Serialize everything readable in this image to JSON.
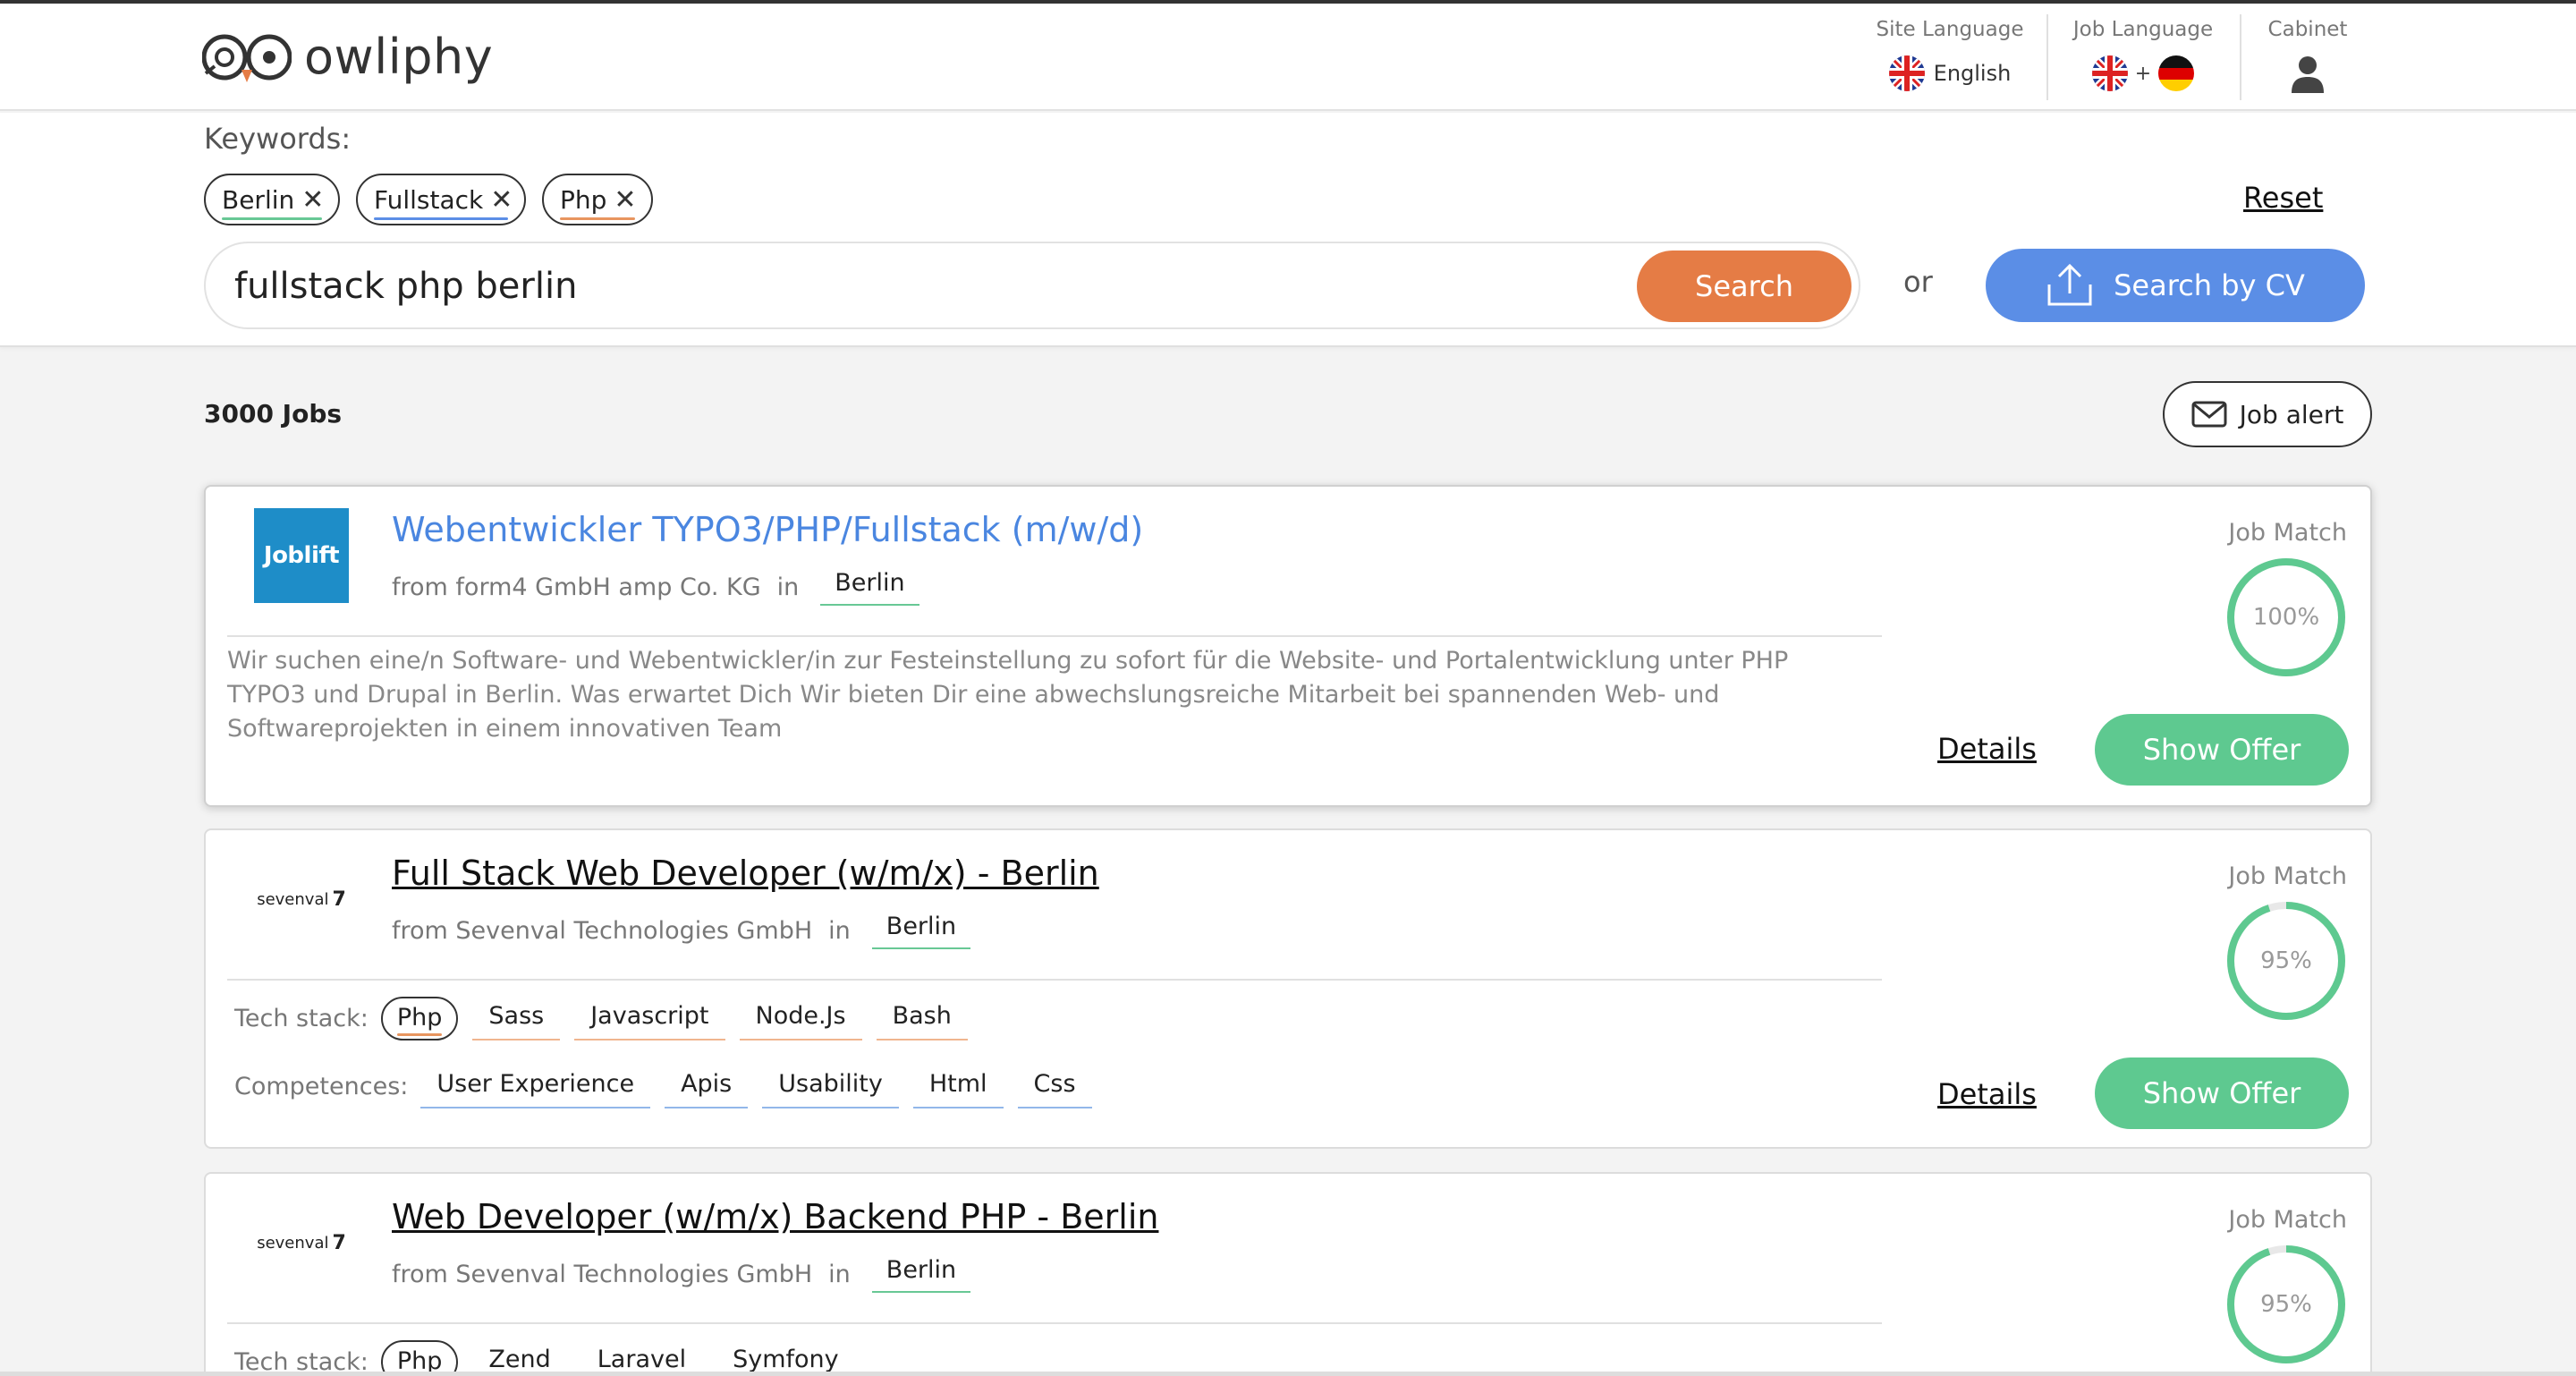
{
  "header": {
    "logo_text": "owliphy",
    "site_language": {
      "label": "Site Language",
      "value": "English"
    },
    "job_language": {
      "label": "Job Language",
      "plus": "+"
    },
    "cabinet": {
      "label": "Cabinet"
    }
  },
  "search": {
    "keywords_label": "Keywords:",
    "chips": [
      {
        "label": "Berlin",
        "accent": "#68c895"
      },
      {
        "label": "Fullstack",
        "accent": "#5b8ee6"
      },
      {
        "label": "Php",
        "accent": "#e8955f"
      }
    ],
    "reset_label": "Reset",
    "query": "fullstack php berlin",
    "search_button": "Search",
    "or_label": "or",
    "cv_button": "Search by CV"
  },
  "results": {
    "count": "3000 Jobs",
    "alert_button": "Job alert",
    "match_label": "Job Match",
    "details_label": "Details",
    "offer_label": "Show Offer",
    "in_label": "in",
    "tech_label": "Tech stack:",
    "comp_label": "Competences:",
    "jobs": [
      {
        "logo": "Joblift",
        "title": "Webentwickler TYPO3/PHP/Fullstack (m/w/d)",
        "from": "from form4 GmbH amp Co. KG",
        "city": "Berlin",
        "match": "100%",
        "match_value": 1.0,
        "description": "Wir suchen eine/n Software- und Webentwickler/in zur Festeinstellung zu sofort für die Website- und Portalentwicklung unter PHP TYPO3 und Drupal in Berlin. Was erwartet Dich Wir bieten Dir eine abwechslungsreiche Mitarbeit bei spannenden Web- und Softwareprojekten in einem innovativen Team"
      },
      {
        "logo": "sevenval",
        "title": "Full Stack Web Developer (w/m/x) - Berlin",
        "from": "from Sevenval Technologies GmbH",
        "city": "Berlin",
        "match": "95%",
        "match_value": 0.95,
        "tech": [
          "Php",
          "Sass",
          "Javascript",
          "Node.Js",
          "Bash"
        ],
        "competences": [
          "User Experience",
          "Apis",
          "Usability",
          "Html",
          "Css"
        ]
      },
      {
        "logo": "sevenval",
        "title": "Web Developer (w/m/x) Backend PHP - Berlin",
        "from": "from Sevenval Technologies GmbH",
        "city": "Berlin",
        "match": "95%",
        "match_value": 0.95,
        "tech": [
          "Php",
          "Zend",
          "Laravel",
          "Symfony"
        ]
      }
    ]
  },
  "colors": {
    "orange": "#e57c45",
    "blue": "#5b8ee6",
    "green": "#5ec990",
    "link_blue": "#4a86e0"
  }
}
